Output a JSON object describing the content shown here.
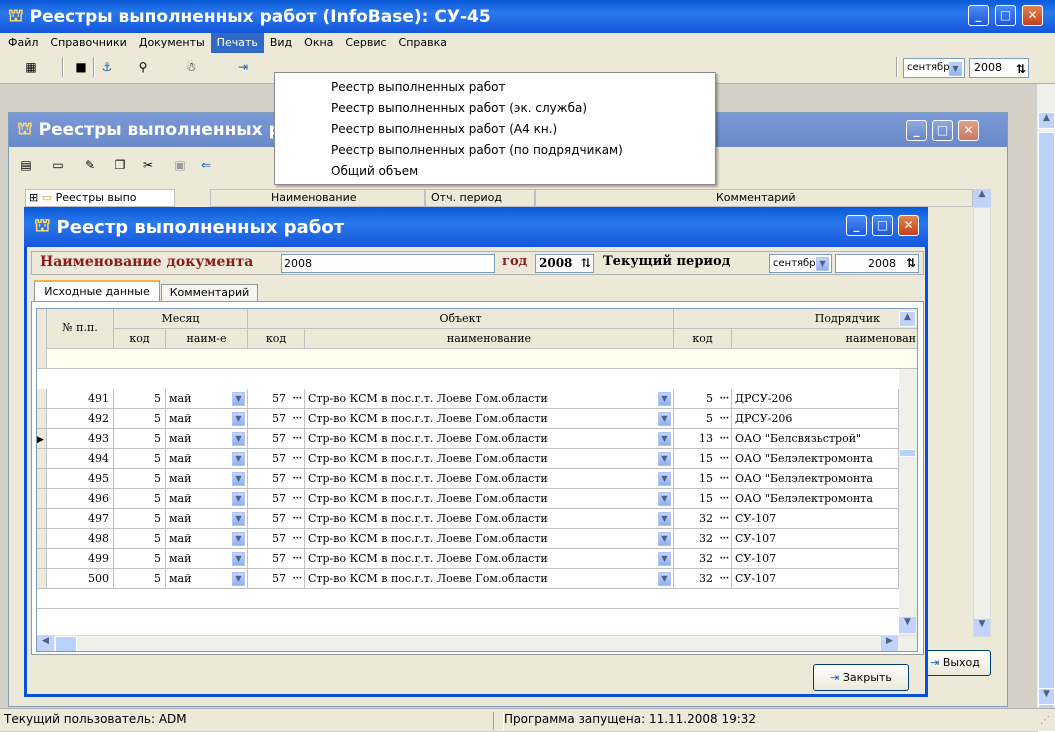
{
  "app": {
    "title": "Реестры выполненных работ (InfoBase): СУ-45"
  },
  "menu": [
    "Файл",
    "Справочники",
    "Документы",
    "Печать",
    "Вид",
    "Окна",
    "Сервис",
    "Справка"
  ],
  "dropdown": [
    "Реестр выполненных работ",
    "Реестр выполненных работ (эк. служба)",
    "Реестр выполненных работ (А4 кн.)",
    "Реестр выполненных работ (по подрядчикам)",
    "Общий объем"
  ],
  "toolbar": {
    "month": "сентябрь",
    "year": "2008"
  },
  "mid": {
    "title": "Реестры выполненных работ",
    "tree_label": "Реестры выпо",
    "col_name": "Наименование",
    "col_period": "Отч. период",
    "col_comment": "Комментарий",
    "exit_label": "Выход"
  },
  "dialog": {
    "title": "Реестр выполненных работ",
    "doc_label": "Наименование документа",
    "doc_value": "2008",
    "year_label": "год",
    "year_value": "2008",
    "period_label": "Текущий период",
    "period_month": "сентябрь",
    "period_year": "2008",
    "tabs": [
      "Исходные данные",
      "Комментарий"
    ],
    "close_label": "Закрыть",
    "headers": {
      "num": "№ п.п.",
      "month": "Месяц",
      "month_code": "код",
      "month_name": "наим-е",
      "object": "Объект",
      "obj_code": "код",
      "obj_name": "наименование",
      "contractor": "Подрядчик",
      "con_code": "код",
      "con_name": "наименован"
    },
    "rows": [
      {
        "n": "491",
        "mc": "5",
        "mn": "май",
        "oc": "57",
        "on": "Стр-во КСМ в пос.г.т. Лоеве Гом.области",
        "cc": "5",
        "cn": "ДРСУ-206"
      },
      {
        "n": "492",
        "mc": "5",
        "mn": "май",
        "oc": "57",
        "on": "Стр-во КСМ в пос.г.т. Лоеве Гом.области",
        "cc": "5",
        "cn": "ДРСУ-206"
      },
      {
        "n": "493",
        "mc": "5",
        "mn": "май",
        "oc": "57",
        "on": "Стр-во КСМ в пос.г.т. Лоеве Гом.области",
        "cc": "13",
        "cn": "ОАО \"Белсвязьстрой\""
      },
      {
        "n": "494",
        "mc": "5",
        "mn": "май",
        "oc": "57",
        "on": "Стр-во КСМ в пос.г.т. Лоеве Гом.области",
        "cc": "15",
        "cn": "ОАО \"Белэлектромонта"
      },
      {
        "n": "495",
        "mc": "5",
        "mn": "май",
        "oc": "57",
        "on": "Стр-во КСМ в пос.г.т. Лоеве Гом.области",
        "cc": "15",
        "cn": "ОАО \"Белэлектромонта"
      },
      {
        "n": "496",
        "mc": "5",
        "mn": "май",
        "oc": "57",
        "on": "Стр-во КСМ в пос.г.т. Лоеве Гом.области",
        "cc": "15",
        "cn": "ОАО \"Белэлектромонта"
      },
      {
        "n": "497",
        "mc": "5",
        "mn": "май",
        "oc": "57",
        "on": "Стр-во КСМ в пос.г.т. Лоеве Гом.области",
        "cc": "32",
        "cn": "СУ-107"
      },
      {
        "n": "498",
        "mc": "5",
        "mn": "май",
        "oc": "57",
        "on": "Стр-во КСМ в пос.г.т. Лоеве Гом.области",
        "cc": "32",
        "cn": "СУ-107"
      },
      {
        "n": "499",
        "mc": "5",
        "mn": "май",
        "oc": "57",
        "on": "Стр-во КСМ в пос.г.т. Лоеве Гом.области",
        "cc": "32",
        "cn": "СУ-107"
      },
      {
        "n": "500",
        "mc": "5",
        "mn": "май",
        "oc": "57",
        "on": "Стр-во КСМ в пос.г.т. Лоеве Гом.области",
        "cc": "32",
        "cn": "СУ-107"
      }
    ]
  },
  "status": {
    "user": "Текущий пользователь: ADM",
    "started": "Программа запущена: 11.11.2008 19:32"
  }
}
